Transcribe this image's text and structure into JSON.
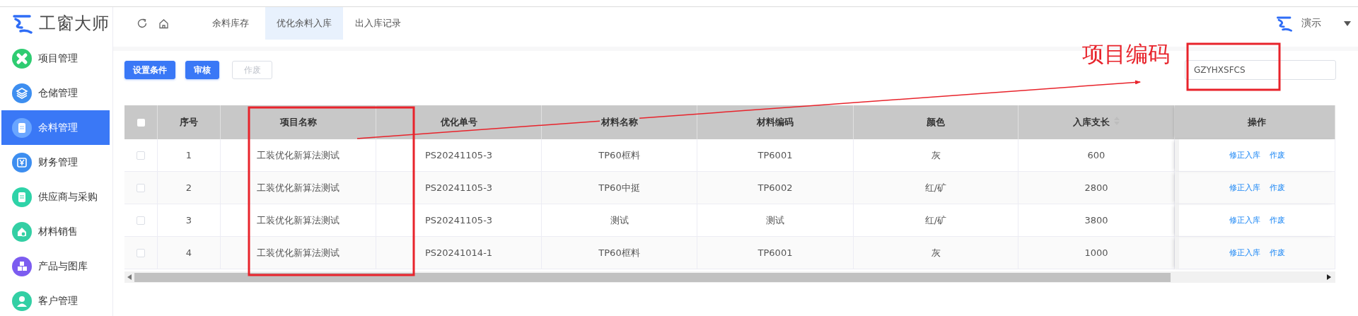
{
  "brand": {
    "name": "工窗大师"
  },
  "sidebar": {
    "items": [
      {
        "label": "项目管理",
        "selected": false
      },
      {
        "label": "仓储管理",
        "selected": false
      },
      {
        "label": "余料管理",
        "selected": true
      },
      {
        "label": "财务管理",
        "selected": false
      },
      {
        "label": "供应商与采购",
        "selected": false
      },
      {
        "label": "材料销售",
        "selected": false
      },
      {
        "label": "产品与图库",
        "selected": false
      },
      {
        "label": "客户管理",
        "selected": false
      }
    ]
  },
  "header": {
    "tabs": [
      {
        "label": "余料库存",
        "selected": false
      },
      {
        "label": "优化余料入库",
        "selected": true
      },
      {
        "label": "出入库记录",
        "selected": false
      }
    ],
    "user": {
      "name": "演示"
    }
  },
  "toolbar": {
    "buttons": [
      {
        "label": "设置条件",
        "disabled": false
      },
      {
        "label": "审核",
        "disabled": false
      },
      {
        "label": "作废",
        "disabled": true
      }
    ],
    "search": {
      "value": "GZYHXSFCS"
    }
  },
  "table": {
    "all_checked": false,
    "columns": [
      {
        "label": "序号",
        "sortable": false
      },
      {
        "label": "项目名称",
        "sortable": false
      },
      {
        "label": "优化单号",
        "sortable": false
      },
      {
        "label": "材料名称",
        "sortable": false
      },
      {
        "label": "材料编码",
        "sortable": false
      },
      {
        "label": "颜色",
        "sortable": false
      },
      {
        "label": "入库支长",
        "sortable": true
      },
      {
        "label": "操作",
        "sortable": false
      }
    ],
    "rows": [
      {
        "checked": false,
        "cells": [
          "1",
          "工装优化新算法测试",
          "PS20241105-3",
          "TP60框料",
          "TP6001",
          "灰",
          "600"
        ],
        "actions": [
          "修正入库",
          "作废"
        ]
      },
      {
        "checked": false,
        "cells": [
          "2",
          "工装优化新算法测试",
          "PS20241105-3",
          "TP60中挺",
          "TP6002",
          "红/矿",
          "2800"
        ],
        "actions": [
          "修正入库",
          "作废"
        ]
      },
      {
        "checked": false,
        "cells": [
          "3",
          "工装优化新算法测试",
          "PS20241105-3",
          "测试",
          "测试",
          "红/矿",
          "3800"
        ],
        "actions": [
          "修正入库",
          "作废"
        ]
      },
      {
        "checked": false,
        "cells": [
          "4",
          "工装优化新算法测试",
          "PS20241014-1",
          "TP60框料",
          "TP6001",
          "灰",
          "1000"
        ],
        "actions": [
          "修正入库",
          "作废"
        ]
      }
    ]
  },
  "annotation": {
    "label": "项目编码"
  }
}
